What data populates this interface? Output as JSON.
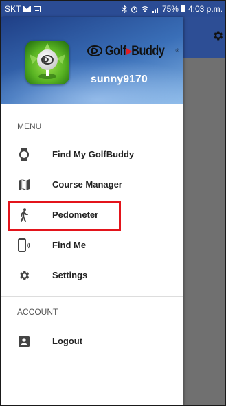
{
  "status_bar": {
    "carrier": "SKT",
    "battery": "75%",
    "time": "4:03 p.m."
  },
  "drawer": {
    "brand": {
      "mark": "Golf",
      "mark_accent": "Buddy",
      "reg": "®"
    },
    "username": "sunny9170",
    "menu_section": "MENU",
    "menu_items": [
      {
        "label": "Find My GolfBuddy",
        "icon": "watch-icon"
      },
      {
        "label": "Course Manager",
        "icon": "map-icon"
      },
      {
        "label": "Pedometer",
        "icon": "walk-icon",
        "highlighted": true
      },
      {
        "label": "Find Me",
        "icon": "phone-vibrate-icon"
      },
      {
        "label": "Settings",
        "icon": "gear-icon"
      }
    ],
    "account_section": "ACCOUNT",
    "account_items": [
      {
        "label": "Logout",
        "icon": "account-box-icon"
      }
    ]
  },
  "colors": {
    "status_bar": "#2b4c94",
    "highlight": "#e3141b",
    "icon": "#444444"
  }
}
